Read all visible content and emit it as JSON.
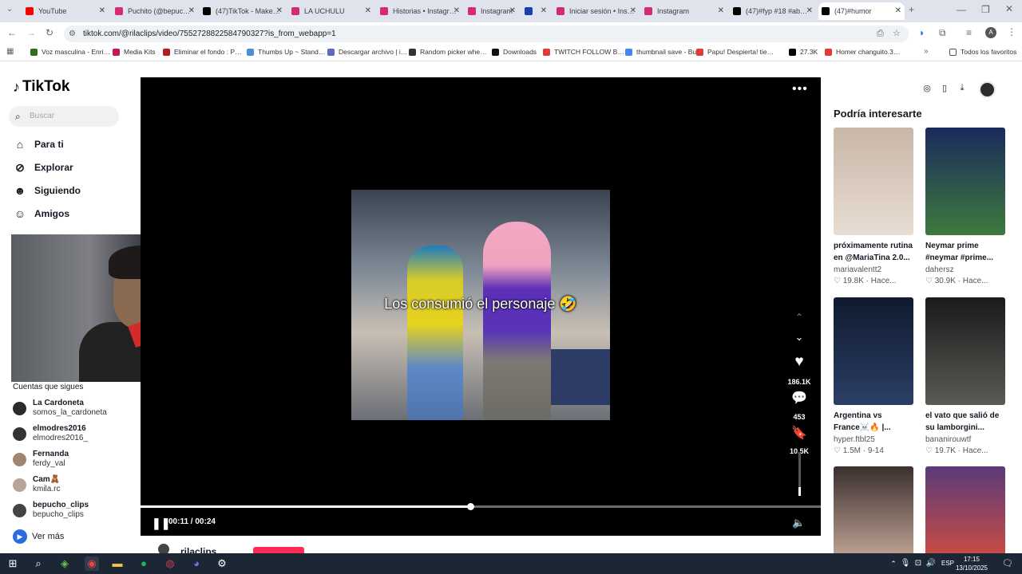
{
  "browser": {
    "tabs": [
      {
        "label": "YouTube",
        "color": "#ff0000"
      },
      {
        "label": "Puchito (@bepuc…",
        "color": "#d62976"
      },
      {
        "label": "(47)TikTok - Make…",
        "color": "#000000"
      },
      {
        "label": "LA UCHULU",
        "color": "#d62976"
      },
      {
        "label": "Historias • Instagr…",
        "color": "#d62976"
      },
      {
        "label": "Instagram",
        "color": "#d62976"
      },
      {
        "label": "",
        "color": "#1a3fb0"
      },
      {
        "label": "Iniciar sesión • Ins…",
        "color": "#d62976"
      },
      {
        "label": "Instagram",
        "color": "#d62976"
      },
      {
        "label": "(47)#fyp #18 #ab…",
        "color": "#000000"
      },
      {
        "label": "(47)#humor",
        "color": "#000000"
      }
    ],
    "url": "tiktok.com/@rilaclips/video/7552728822584790327?is_from_webapp=1",
    "bookmarks": [
      {
        "label": "Voz masculina - Enri…",
        "color": "#2f6d1f"
      },
      {
        "label": "Media Kits",
        "color": "#c2185b"
      },
      {
        "label": "Eliminar el fondo : P…",
        "color": "#b71c1c"
      },
      {
        "label": "Thumbs Up ~ Stand…",
        "color": "#4a90d9"
      },
      {
        "label": "Descargar archivo | i…",
        "color": "#5c6bc0"
      },
      {
        "label": "Random picker whe…",
        "color": "#333333"
      },
      {
        "label": "Downloads",
        "color": "#111111"
      },
      {
        "label": "TWITCH FOLLOW B…",
        "color": "#e53935"
      },
      {
        "label": "thumbnail save - Bu…",
        "color": "#4285f4"
      },
      {
        "label": "Papu! Despierta! tie…",
        "color": "#e53935"
      },
      {
        "label": "27.3K",
        "color": "#000000"
      },
      {
        "label": "Homer changuito.3…",
        "color": "#e53935"
      }
    ],
    "all_favorites": "Todos los favoritos"
  },
  "sidebar": {
    "logo": "TikTok",
    "search_placeholder": "Buscar",
    "nav": [
      {
        "label": "Para ti",
        "icon": "home-icon"
      },
      {
        "label": "Explorar",
        "icon": "compass-icon"
      },
      {
        "label": "Siguiendo",
        "icon": "following-icon"
      },
      {
        "label": "Amigos",
        "icon": "friends-icon"
      }
    ],
    "following_title": "Cuentas que sigues",
    "accounts": [
      {
        "name": "La Cardoneta",
        "handle": "somos_la_cardoneta"
      },
      {
        "name": "elmodres2016",
        "handle": "elmodres2016_"
      },
      {
        "name": "Fernanda",
        "handle": "ferdy_val"
      },
      {
        "name": "Cam🧸",
        "handle": "kmila.rc"
      },
      {
        "name": "bepucho_clips",
        "handle": "bepucho_clips"
      }
    ],
    "see_more": "Ver más"
  },
  "video": {
    "caption": "Los consumió el personaje 🤣",
    "likes": "186.1K",
    "comments": "453",
    "saves": "10.5K",
    "time": "00:11 / 00:24",
    "progress": 0.485,
    "volume": 0.2,
    "author": "rilaclips"
  },
  "recommended": {
    "title": "Podría interesarte",
    "items": [
      {
        "caption": "próximamente rutina en @MariaTina 2.0...",
        "user": "mariavalentt2",
        "likes": "19.8K",
        "age": "Hace...",
        "colors": [
          "#c9b7a8",
          "#e8ddd3"
        ]
      },
      {
        "caption": "Neymar prime #neymar #prime...",
        "user": "dahersz",
        "likes": "30.9K",
        "age": "Hace...",
        "colors": [
          "#1b2a5c",
          "#3d7a3e"
        ]
      },
      {
        "caption": "Argentina vs France☠️🔥 |...",
        "user": "hyper.ftbl25",
        "likes": "1.5M",
        "age": "9-14",
        "colors": [
          "#0f1a2e",
          "#2b3f66"
        ]
      },
      {
        "caption": "el vato que salió de su lamborgini...",
        "user": "bananirouwtf",
        "likes": "19.7K",
        "age": "Hace...",
        "colors": [
          "#1a1a1a",
          "#5b5a55"
        ]
      },
      {
        "caption": "",
        "user": "",
        "likes": "",
        "age": "",
        "colors": [
          "#3a2f2e",
          "#d8b9a6"
        ]
      },
      {
        "caption": "",
        "user": "",
        "likes": "",
        "age": "",
        "colors": [
          "#5a3a7a",
          "#e0503a"
        ]
      }
    ]
  },
  "taskbar": {
    "time": "17:15",
    "date": "13/10/2025",
    "lang": "ESP"
  }
}
